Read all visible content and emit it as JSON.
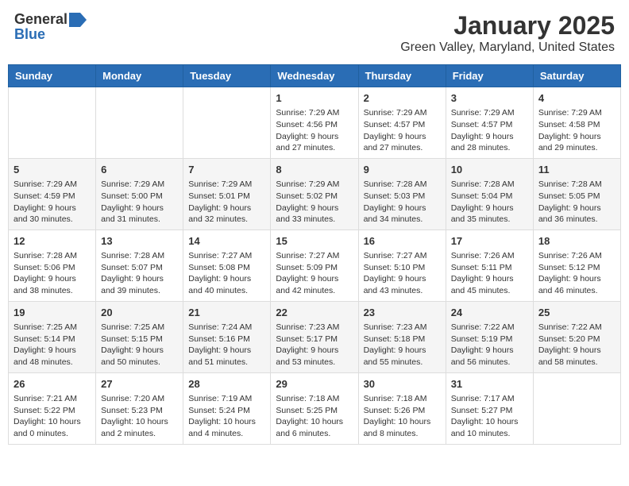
{
  "header": {
    "logo_general": "General",
    "logo_blue": "Blue",
    "month": "January 2025",
    "location": "Green Valley, Maryland, United States"
  },
  "weekdays": [
    "Sunday",
    "Monday",
    "Tuesday",
    "Wednesday",
    "Thursday",
    "Friday",
    "Saturday"
  ],
  "weeks": [
    [
      {
        "day": "",
        "info": ""
      },
      {
        "day": "",
        "info": ""
      },
      {
        "day": "",
        "info": ""
      },
      {
        "day": "1",
        "info": "Sunrise: 7:29 AM\nSunset: 4:56 PM\nDaylight: 9 hours and 27 minutes."
      },
      {
        "day": "2",
        "info": "Sunrise: 7:29 AM\nSunset: 4:57 PM\nDaylight: 9 hours and 27 minutes."
      },
      {
        "day": "3",
        "info": "Sunrise: 7:29 AM\nSunset: 4:57 PM\nDaylight: 9 hours and 28 minutes."
      },
      {
        "day": "4",
        "info": "Sunrise: 7:29 AM\nSunset: 4:58 PM\nDaylight: 9 hours and 29 minutes."
      }
    ],
    [
      {
        "day": "5",
        "info": "Sunrise: 7:29 AM\nSunset: 4:59 PM\nDaylight: 9 hours and 30 minutes."
      },
      {
        "day": "6",
        "info": "Sunrise: 7:29 AM\nSunset: 5:00 PM\nDaylight: 9 hours and 31 minutes."
      },
      {
        "day": "7",
        "info": "Sunrise: 7:29 AM\nSunset: 5:01 PM\nDaylight: 9 hours and 32 minutes."
      },
      {
        "day": "8",
        "info": "Sunrise: 7:29 AM\nSunset: 5:02 PM\nDaylight: 9 hours and 33 minutes."
      },
      {
        "day": "9",
        "info": "Sunrise: 7:28 AM\nSunset: 5:03 PM\nDaylight: 9 hours and 34 minutes."
      },
      {
        "day": "10",
        "info": "Sunrise: 7:28 AM\nSunset: 5:04 PM\nDaylight: 9 hours and 35 minutes."
      },
      {
        "day": "11",
        "info": "Sunrise: 7:28 AM\nSunset: 5:05 PM\nDaylight: 9 hours and 36 minutes."
      }
    ],
    [
      {
        "day": "12",
        "info": "Sunrise: 7:28 AM\nSunset: 5:06 PM\nDaylight: 9 hours and 38 minutes."
      },
      {
        "day": "13",
        "info": "Sunrise: 7:28 AM\nSunset: 5:07 PM\nDaylight: 9 hours and 39 minutes."
      },
      {
        "day": "14",
        "info": "Sunrise: 7:27 AM\nSunset: 5:08 PM\nDaylight: 9 hours and 40 minutes."
      },
      {
        "day": "15",
        "info": "Sunrise: 7:27 AM\nSunset: 5:09 PM\nDaylight: 9 hours and 42 minutes."
      },
      {
        "day": "16",
        "info": "Sunrise: 7:27 AM\nSunset: 5:10 PM\nDaylight: 9 hours and 43 minutes."
      },
      {
        "day": "17",
        "info": "Sunrise: 7:26 AM\nSunset: 5:11 PM\nDaylight: 9 hours and 45 minutes."
      },
      {
        "day": "18",
        "info": "Sunrise: 7:26 AM\nSunset: 5:12 PM\nDaylight: 9 hours and 46 minutes."
      }
    ],
    [
      {
        "day": "19",
        "info": "Sunrise: 7:25 AM\nSunset: 5:14 PM\nDaylight: 9 hours and 48 minutes."
      },
      {
        "day": "20",
        "info": "Sunrise: 7:25 AM\nSunset: 5:15 PM\nDaylight: 9 hours and 50 minutes."
      },
      {
        "day": "21",
        "info": "Sunrise: 7:24 AM\nSunset: 5:16 PM\nDaylight: 9 hours and 51 minutes."
      },
      {
        "day": "22",
        "info": "Sunrise: 7:23 AM\nSunset: 5:17 PM\nDaylight: 9 hours and 53 minutes."
      },
      {
        "day": "23",
        "info": "Sunrise: 7:23 AM\nSunset: 5:18 PM\nDaylight: 9 hours and 55 minutes."
      },
      {
        "day": "24",
        "info": "Sunrise: 7:22 AM\nSunset: 5:19 PM\nDaylight: 9 hours and 56 minutes."
      },
      {
        "day": "25",
        "info": "Sunrise: 7:22 AM\nSunset: 5:20 PM\nDaylight: 9 hours and 58 minutes."
      }
    ],
    [
      {
        "day": "26",
        "info": "Sunrise: 7:21 AM\nSunset: 5:22 PM\nDaylight: 10 hours and 0 minutes."
      },
      {
        "day": "27",
        "info": "Sunrise: 7:20 AM\nSunset: 5:23 PM\nDaylight: 10 hours and 2 minutes."
      },
      {
        "day": "28",
        "info": "Sunrise: 7:19 AM\nSunset: 5:24 PM\nDaylight: 10 hours and 4 minutes."
      },
      {
        "day": "29",
        "info": "Sunrise: 7:18 AM\nSunset: 5:25 PM\nDaylight: 10 hours and 6 minutes."
      },
      {
        "day": "30",
        "info": "Sunrise: 7:18 AM\nSunset: 5:26 PM\nDaylight: 10 hours and 8 minutes."
      },
      {
        "day": "31",
        "info": "Sunrise: 7:17 AM\nSunset: 5:27 PM\nDaylight: 10 hours and 10 minutes."
      },
      {
        "day": "",
        "info": ""
      }
    ]
  ]
}
